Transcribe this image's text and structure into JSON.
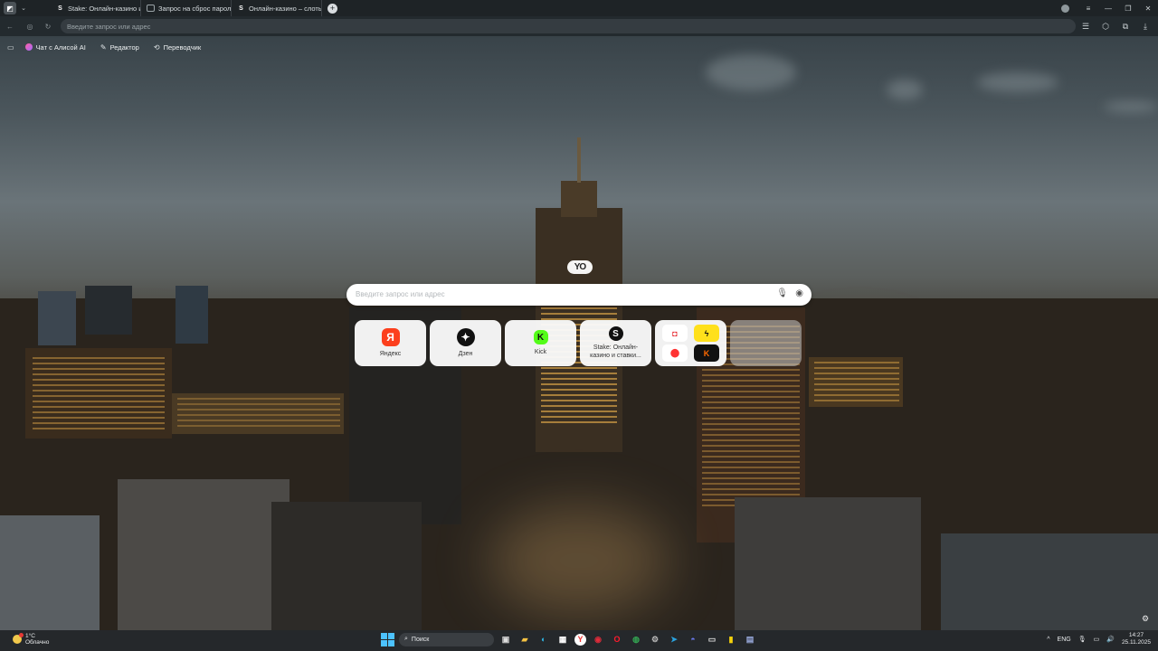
{
  "browser": {
    "tabs": [
      {
        "icon": "S",
        "title": "Stake: Онлайн-казино и с"
      },
      {
        "icon": "",
        "title": "Запрос на сброс пароля"
      },
      {
        "icon": "S",
        "title": "Онлайн-казино – слоты"
      }
    ],
    "newtab_icon": "+",
    "address_placeholder": "Введите запрос или адрес"
  },
  "bookmarks": [
    {
      "label": "Чат с Алисой AI"
    },
    {
      "label": "Редактор"
    },
    {
      "label": "Переводчик"
    }
  ],
  "newtab": {
    "logo": "YO",
    "search_placeholder": "Введите запрос или адрес",
    "tiles": [
      {
        "label": "Яндекс",
        "icon": "Я",
        "color": "#fc3f1d"
      },
      {
        "label": "Дзен",
        "icon": "✦",
        "color": "#111111"
      },
      {
        "label": "Kick",
        "icon": "K",
        "color": "#53fc18"
      },
      {
        "label": "Stake: Онлайн-казино и ставки...",
        "icon": "S",
        "color": "#111111"
      }
    ]
  },
  "taskbar": {
    "weather_temp": "1°C",
    "weather_desc": "Облачно",
    "search_label": "Поиск",
    "language": "ENG",
    "time": "14:27",
    "date": "25.11.2025"
  }
}
